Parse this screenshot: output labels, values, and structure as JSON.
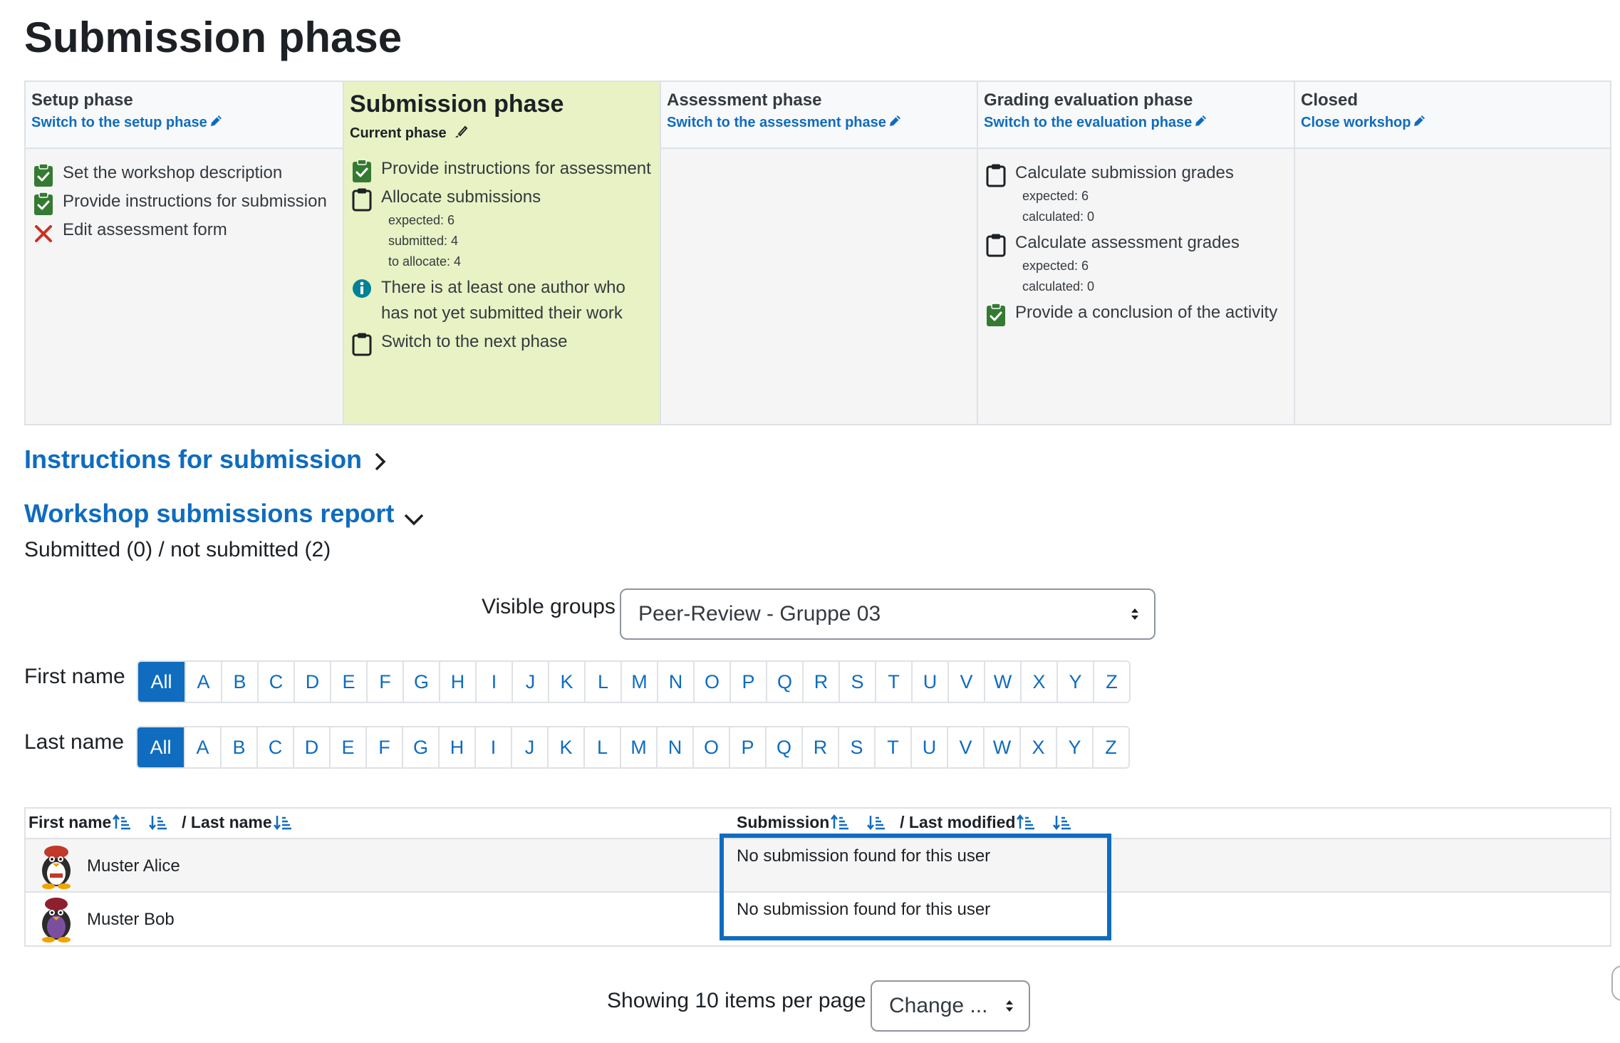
{
  "page_title": "Submission phase",
  "phases": [
    {
      "name": "Setup phase",
      "link": "Switch to the setup phase",
      "tasks": [
        {
          "status": "done",
          "text": "Set the workshop description"
        },
        {
          "status": "done",
          "text": "Provide instructions for submission"
        },
        {
          "status": "fail",
          "text": "Edit assessment form"
        }
      ]
    },
    {
      "name": "Submission phase",
      "current_label": "Current phase",
      "tasks": [
        {
          "status": "done",
          "text": "Provide instructions for assessment"
        },
        {
          "status": "todo",
          "text": "Allocate submissions",
          "details": [
            "expected: 6",
            "submitted: 4",
            "to allocate: 4"
          ]
        },
        {
          "status": "info",
          "text": "There is at least one author who has not yet submitted their work"
        },
        {
          "status": "todo",
          "text": "Switch to the next phase"
        }
      ]
    },
    {
      "name": "Assessment phase",
      "link": "Switch to the assessment phase",
      "tasks": []
    },
    {
      "name": "Grading evaluation phase",
      "link": "Switch to the evaluation phase",
      "tasks": [
        {
          "status": "todo",
          "text": "Calculate submission grades",
          "details": [
            "expected: 6",
            "calculated: 0"
          ]
        },
        {
          "status": "todo",
          "text": "Calculate assessment grades",
          "details": [
            "expected: 6",
            "calculated: 0"
          ]
        },
        {
          "status": "done",
          "text": "Provide a conclusion of the activity"
        }
      ]
    },
    {
      "name": "Closed",
      "link": "Close workshop",
      "tasks": []
    }
  ],
  "instructions_heading": "Instructions for submission",
  "report_heading": "Workshop submissions report",
  "summary": "Submitted (0) / not submitted (2)",
  "groups": {
    "label": "Visible groups",
    "selected": "Peer-Review - Gruppe 03"
  },
  "initials": {
    "first_label": "First name",
    "last_label": "Last name",
    "all": "All",
    "letters": [
      "A",
      "B",
      "C",
      "D",
      "E",
      "F",
      "G",
      "H",
      "I",
      "J",
      "K",
      "L",
      "M",
      "N",
      "O",
      "P",
      "Q",
      "R",
      "S",
      "T",
      "U",
      "V",
      "W",
      "X",
      "Y",
      "Z"
    ]
  },
  "table": {
    "col_first": "First name",
    "col_last": "/ Last name",
    "col_submission": "Submission",
    "col_modified": "/ Last modified",
    "rows": [
      {
        "name": "Muster Alice",
        "submission": "No submission found for this user"
      },
      {
        "name": "Muster Bob",
        "submission": "No submission found for this user"
      }
    ]
  },
  "perpage": {
    "label": "Showing 10 items per page",
    "select": "Change ..."
  },
  "colors": {
    "accent": "#0f6cbf",
    "active_phase": "#e8f2c4",
    "done": "#357a32",
    "fail": "#ca3120",
    "info": "#008196"
  }
}
